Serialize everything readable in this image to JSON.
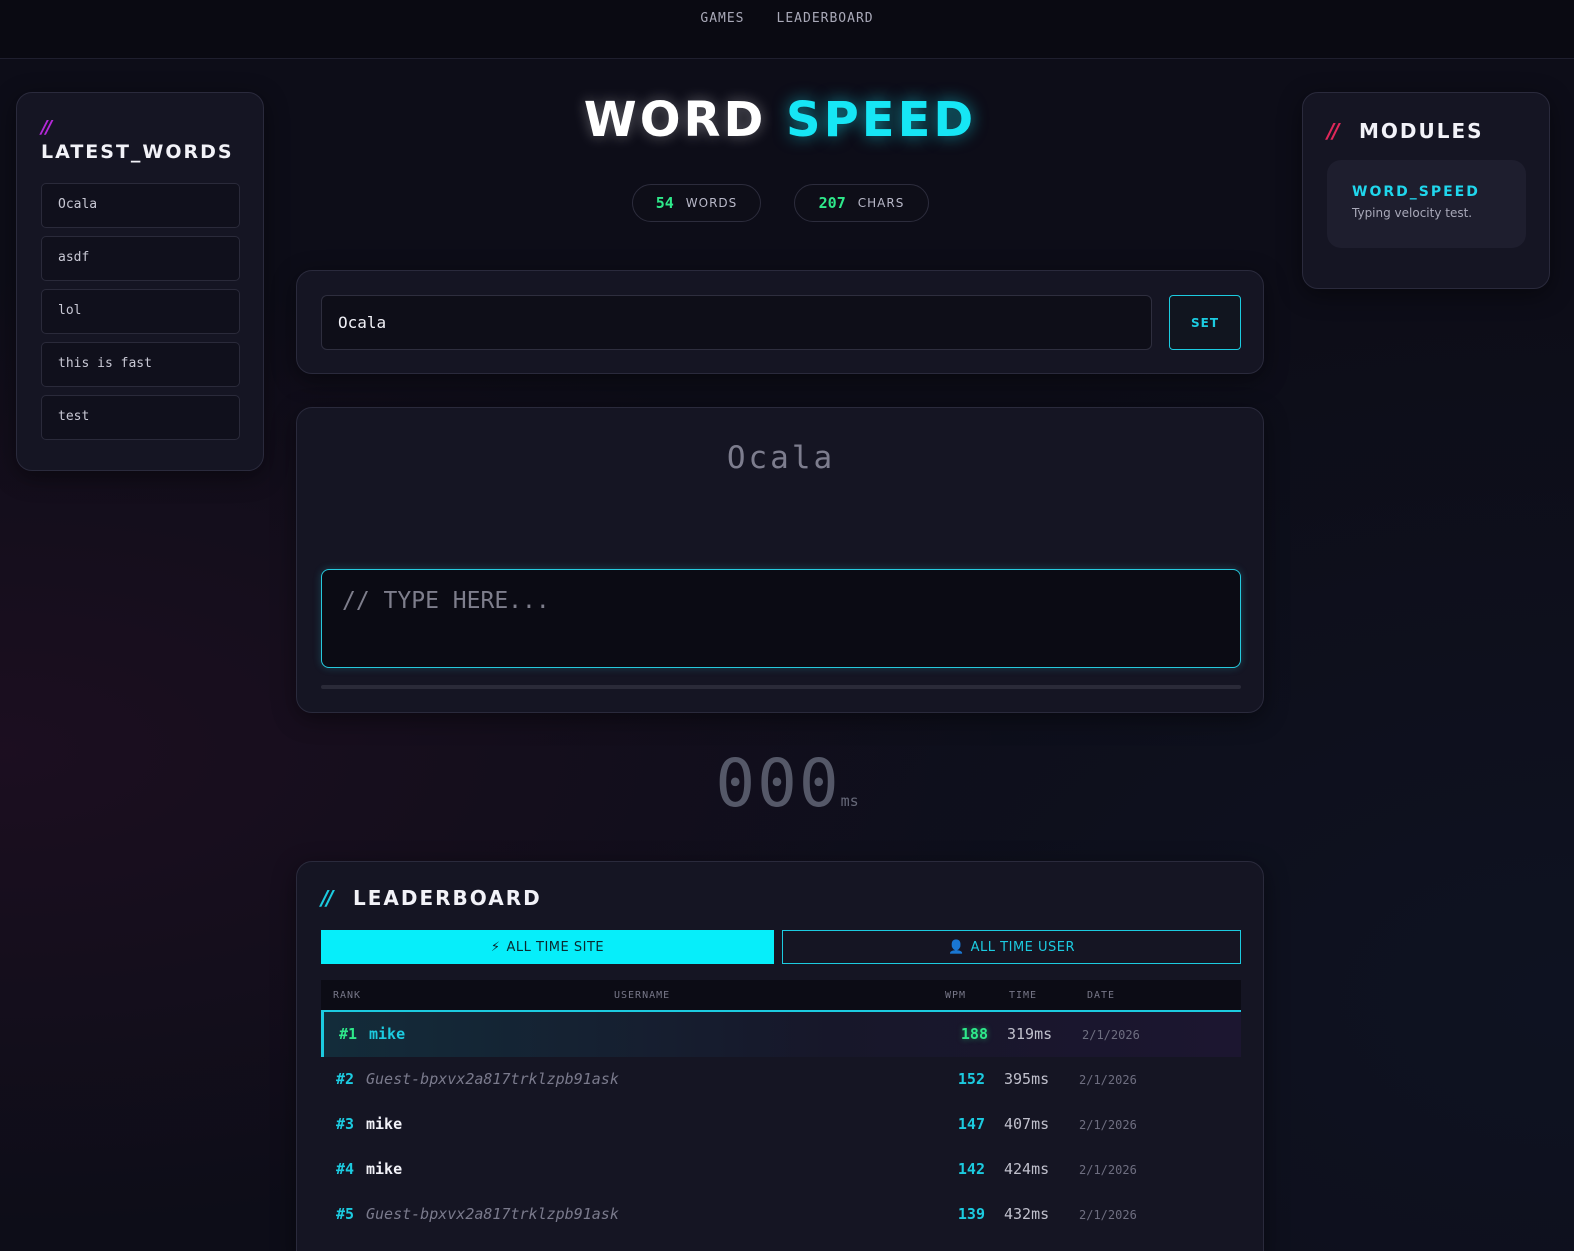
{
  "nav": {
    "items": [
      "GAMES",
      "LEADERBOARD"
    ]
  },
  "latest_words": {
    "slashes": "//",
    "title": "LATEST_WORDS",
    "items": [
      "Ocala",
      "asdf",
      "lol",
      "this is fast",
      "test"
    ]
  },
  "modules": {
    "slashes": "//",
    "title": "MODULES",
    "card": {
      "name": "WORD_SPEED",
      "description": "Typing velocity test."
    }
  },
  "title": {
    "part1": "WORD",
    "part2": "SPEED"
  },
  "stats": {
    "words": {
      "value": "54",
      "label": "WORDS"
    },
    "chars": {
      "value": "207",
      "label": "CHARS"
    }
  },
  "set_word": {
    "value": "Ocala",
    "button": "SET"
  },
  "typing": {
    "target": "Ocala",
    "placeholder": "// TYPE HERE...",
    "progress": 0
  },
  "timer": {
    "value": "000",
    "unit": "ms"
  },
  "leaderboard": {
    "slashes": "//",
    "title": "LEADERBOARD",
    "tabs": {
      "site": {
        "icon": "⚡",
        "label": "ALL TIME SITE"
      },
      "user": {
        "icon": "👤",
        "label": "ALL TIME USER"
      }
    },
    "columns": {
      "rank": "RANK",
      "username": "USERNAME",
      "wpm": "WPM",
      "time": "TIME",
      "date": "DATE"
    },
    "rows": [
      {
        "rank": "#1",
        "username": "mike",
        "guest": false,
        "wpm": "188",
        "time": "319ms",
        "date": "2/1/2026"
      },
      {
        "rank": "#2",
        "username": "Guest-bpxvx2a817trklzpb91ask",
        "guest": true,
        "wpm": "152",
        "time": "395ms",
        "date": "2/1/2026"
      },
      {
        "rank": "#3",
        "username": "mike",
        "guest": false,
        "wpm": "147",
        "time": "407ms",
        "date": "2/1/2026"
      },
      {
        "rank": "#4",
        "username": "mike",
        "guest": false,
        "wpm": "142",
        "time": "424ms",
        "date": "2/1/2026"
      },
      {
        "rank": "#5",
        "username": "Guest-bpxvx2a817trklzpb91ask",
        "guest": true,
        "wpm": "139",
        "time": "432ms",
        "date": "2/1/2026"
      }
    ]
  },
  "colors": {
    "accent": "#1ccbe0",
    "green": "#2ee88a",
    "magenta": "#b428d8",
    "red": "#e0285a"
  }
}
